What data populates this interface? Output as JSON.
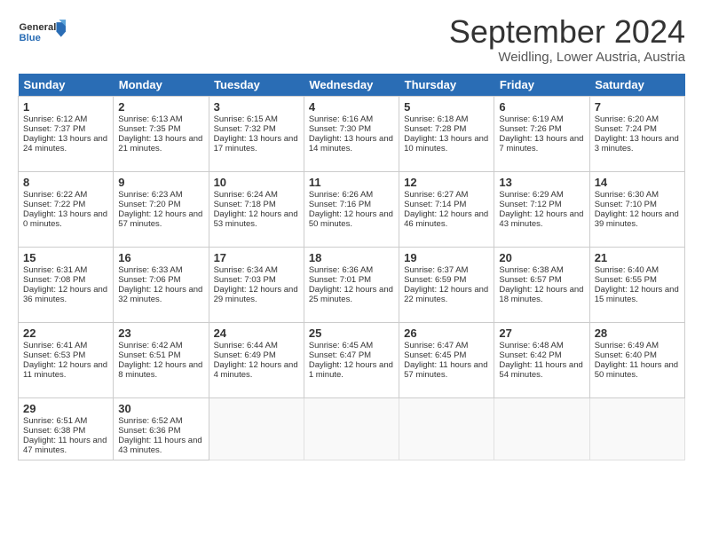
{
  "header": {
    "logo_general": "General",
    "logo_blue": "Blue",
    "month_title": "September 2024",
    "location": "Weidling, Lower Austria, Austria"
  },
  "weekdays": [
    "Sunday",
    "Monday",
    "Tuesday",
    "Wednesday",
    "Thursday",
    "Friday",
    "Saturday"
  ],
  "weeks": [
    [
      {
        "day": "1",
        "sunrise": "6:12 AM",
        "sunset": "7:37 PM",
        "daylight": "13 hours and 24 minutes."
      },
      {
        "day": "2",
        "sunrise": "6:13 AM",
        "sunset": "7:35 PM",
        "daylight": "13 hours and 21 minutes."
      },
      {
        "day": "3",
        "sunrise": "6:15 AM",
        "sunset": "7:32 PM",
        "daylight": "13 hours and 17 minutes."
      },
      {
        "day": "4",
        "sunrise": "6:16 AM",
        "sunset": "7:30 PM",
        "daylight": "13 hours and 14 minutes."
      },
      {
        "day": "5",
        "sunrise": "6:18 AM",
        "sunset": "7:28 PM",
        "daylight": "13 hours and 10 minutes."
      },
      {
        "day": "6",
        "sunrise": "6:19 AM",
        "sunset": "7:26 PM",
        "daylight": "13 hours and 7 minutes."
      },
      {
        "day": "7",
        "sunrise": "6:20 AM",
        "sunset": "7:24 PM",
        "daylight": "13 hours and 3 minutes."
      }
    ],
    [
      {
        "day": "8",
        "sunrise": "6:22 AM",
        "sunset": "7:22 PM",
        "daylight": "13 hours and 0 minutes."
      },
      {
        "day": "9",
        "sunrise": "6:23 AM",
        "sunset": "7:20 PM",
        "daylight": "12 hours and 57 minutes."
      },
      {
        "day": "10",
        "sunrise": "6:24 AM",
        "sunset": "7:18 PM",
        "daylight": "12 hours and 53 minutes."
      },
      {
        "day": "11",
        "sunrise": "6:26 AM",
        "sunset": "7:16 PM",
        "daylight": "12 hours and 50 minutes."
      },
      {
        "day": "12",
        "sunrise": "6:27 AM",
        "sunset": "7:14 PM",
        "daylight": "12 hours and 46 minutes."
      },
      {
        "day": "13",
        "sunrise": "6:29 AM",
        "sunset": "7:12 PM",
        "daylight": "12 hours and 43 minutes."
      },
      {
        "day": "14",
        "sunrise": "6:30 AM",
        "sunset": "7:10 PM",
        "daylight": "12 hours and 39 minutes."
      }
    ],
    [
      {
        "day": "15",
        "sunrise": "6:31 AM",
        "sunset": "7:08 PM",
        "daylight": "12 hours and 36 minutes."
      },
      {
        "day": "16",
        "sunrise": "6:33 AM",
        "sunset": "7:06 PM",
        "daylight": "12 hours and 32 minutes."
      },
      {
        "day": "17",
        "sunrise": "6:34 AM",
        "sunset": "7:03 PM",
        "daylight": "12 hours and 29 minutes."
      },
      {
        "day": "18",
        "sunrise": "6:36 AM",
        "sunset": "7:01 PM",
        "daylight": "12 hours and 25 minutes."
      },
      {
        "day": "19",
        "sunrise": "6:37 AM",
        "sunset": "6:59 PM",
        "daylight": "12 hours and 22 minutes."
      },
      {
        "day": "20",
        "sunrise": "6:38 AM",
        "sunset": "6:57 PM",
        "daylight": "12 hours and 18 minutes."
      },
      {
        "day": "21",
        "sunrise": "6:40 AM",
        "sunset": "6:55 PM",
        "daylight": "12 hours and 15 minutes."
      }
    ],
    [
      {
        "day": "22",
        "sunrise": "6:41 AM",
        "sunset": "6:53 PM",
        "daylight": "12 hours and 11 minutes."
      },
      {
        "day": "23",
        "sunrise": "6:42 AM",
        "sunset": "6:51 PM",
        "daylight": "12 hours and 8 minutes."
      },
      {
        "day": "24",
        "sunrise": "6:44 AM",
        "sunset": "6:49 PM",
        "daylight": "12 hours and 4 minutes."
      },
      {
        "day": "25",
        "sunrise": "6:45 AM",
        "sunset": "6:47 PM",
        "daylight": "12 hours and 1 minute."
      },
      {
        "day": "26",
        "sunrise": "6:47 AM",
        "sunset": "6:45 PM",
        "daylight": "11 hours and 57 minutes."
      },
      {
        "day": "27",
        "sunrise": "6:48 AM",
        "sunset": "6:42 PM",
        "daylight": "11 hours and 54 minutes."
      },
      {
        "day": "28",
        "sunrise": "6:49 AM",
        "sunset": "6:40 PM",
        "daylight": "11 hours and 50 minutes."
      }
    ],
    [
      {
        "day": "29",
        "sunrise": "6:51 AM",
        "sunset": "6:38 PM",
        "daylight": "11 hours and 47 minutes."
      },
      {
        "day": "30",
        "sunrise": "6:52 AM",
        "sunset": "6:36 PM",
        "daylight": "11 hours and 43 minutes."
      },
      null,
      null,
      null,
      null,
      null
    ]
  ]
}
